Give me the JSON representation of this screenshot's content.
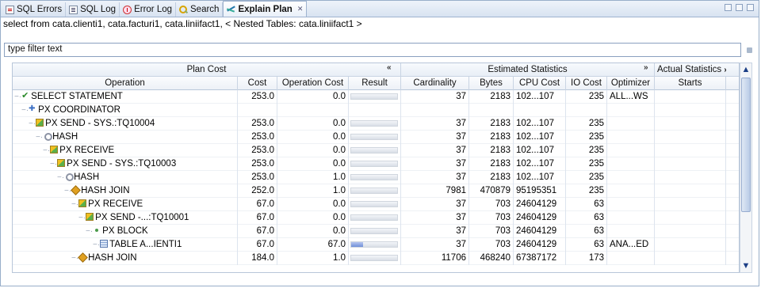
{
  "tabs": [
    {
      "label": "SQL Errors",
      "icon": "sql-errors-icon",
      "active": false
    },
    {
      "label": "SQL Log",
      "icon": "sql-log-icon",
      "active": false
    },
    {
      "label": "Error Log",
      "icon": "error-log-icon",
      "active": false
    },
    {
      "label": "Search",
      "icon": "search-icon",
      "active": false
    },
    {
      "label": "Explain Plan",
      "icon": "explain-plan-icon",
      "active": true
    }
  ],
  "sql_statement": "select from cata.clienti1, cata.facturi1, cata.liniifact1, < Nested Tables: cata.liniifact1 >",
  "filter": {
    "placeholder": "type filter text",
    "value": "type filter text"
  },
  "column_groups": {
    "plan_cost": "Plan Cost",
    "estimated_statistics": "Estimated Statistics",
    "actual_statistics": "Actual Statistics",
    "collapse_glyph": "«",
    "expand_glyph": "»"
  },
  "columns": [
    "Operation",
    "Cost",
    "Operation Cost",
    "Result",
    "Cardinality",
    "Bytes",
    "CPU Cost",
    "IO Cost",
    "Optimizer",
    "Starts"
  ],
  "rows": [
    {
      "depth": 0,
      "icon": "check",
      "operation": "SELECT STATEMENT",
      "cost": "253.0",
      "op_cost": "0.0",
      "result": 0.0,
      "cardinality": "37",
      "bytes": "2183",
      "cpu_cost": "102...107",
      "io_cost": "235",
      "optimizer": "ALL...WS",
      "starts": ""
    },
    {
      "depth": 1,
      "icon": "coord",
      "operation": "PX COORDINATOR",
      "cost": "",
      "op_cost": "",
      "result": null,
      "cardinality": "",
      "bytes": "",
      "cpu_cost": "",
      "io_cost": "",
      "optimizer": "",
      "starts": ""
    },
    {
      "depth": 2,
      "icon": "send",
      "operation": "PX SEND - SYS.:TQ10004",
      "cost": "253.0",
      "op_cost": "0.0",
      "result": 0.0,
      "cardinality": "37",
      "bytes": "2183",
      "cpu_cost": "102...107",
      "io_cost": "235",
      "optimizer": "",
      "starts": ""
    },
    {
      "depth": 3,
      "icon": "hash",
      "operation": "HASH",
      "cost": "253.0",
      "op_cost": "0.0",
      "result": 0.0,
      "cardinality": "37",
      "bytes": "2183",
      "cpu_cost": "102...107",
      "io_cost": "235",
      "optimizer": "",
      "starts": ""
    },
    {
      "depth": 4,
      "icon": "send",
      "operation": "PX RECEIVE",
      "cost": "253.0",
      "op_cost": "0.0",
      "result": 0.0,
      "cardinality": "37",
      "bytes": "2183",
      "cpu_cost": "102...107",
      "io_cost": "235",
      "optimizer": "",
      "starts": ""
    },
    {
      "depth": 5,
      "icon": "send",
      "operation": "PX SEND - SYS.:TQ10003",
      "cost": "253.0",
      "op_cost": "0.0",
      "result": 0.0,
      "cardinality": "37",
      "bytes": "2183",
      "cpu_cost": "102...107",
      "io_cost": "235",
      "optimizer": "",
      "starts": ""
    },
    {
      "depth": 6,
      "icon": "hash",
      "operation": "HASH",
      "cost": "253.0",
      "op_cost": "1.0",
      "result": 0.0,
      "cardinality": "37",
      "bytes": "2183",
      "cpu_cost": "102...107",
      "io_cost": "235",
      "optimizer": "",
      "starts": ""
    },
    {
      "depth": 7,
      "icon": "join",
      "operation": "HASH JOIN",
      "cost": "252.0",
      "op_cost": "1.0",
      "result": 0.0,
      "cardinality": "7981",
      "bytes": "470879",
      "cpu_cost": "95195351",
      "io_cost": "235",
      "optimizer": "",
      "starts": ""
    },
    {
      "depth": 8,
      "icon": "send",
      "operation": "PX RECEIVE",
      "cost": "67.0",
      "op_cost": "0.0",
      "result": 0.0,
      "cardinality": "37",
      "bytes": "703",
      "cpu_cost": "24604129",
      "io_cost": "63",
      "optimizer": "",
      "starts": ""
    },
    {
      "depth": 9,
      "icon": "send",
      "operation": "PX SEND -...:TQ10001",
      "cost": "67.0",
      "op_cost": "0.0",
      "result": 0.0,
      "cardinality": "37",
      "bytes": "703",
      "cpu_cost": "24604129",
      "io_cost": "63",
      "optimizer": "",
      "starts": ""
    },
    {
      "depth": 10,
      "icon": "block",
      "operation": "PX BLOCK",
      "cost": "67.0",
      "op_cost": "0.0",
      "result": 0.0,
      "cardinality": "37",
      "bytes": "703",
      "cpu_cost": "24604129",
      "io_cost": "63",
      "optimizer": "",
      "starts": ""
    },
    {
      "depth": 11,
      "icon": "table",
      "operation": "TABLE A...IENTI1",
      "cost": "67.0",
      "op_cost": "67.0",
      "result": 0.26,
      "cardinality": "37",
      "bytes": "703",
      "cpu_cost": "24604129",
      "io_cost": "63",
      "optimizer": "ANA...ED",
      "starts": ""
    },
    {
      "depth": 8,
      "icon": "join",
      "operation": "HASH JOIN",
      "cost": "184.0",
      "op_cost": "1.0",
      "result": 0.0,
      "cardinality": "11706",
      "bytes": "468240",
      "cpu_cost": "67387172",
      "io_cost": "173",
      "optimizer": "",
      "starts": ""
    }
  ],
  "scrollbar": {
    "up_glyph": "▲",
    "down_glyph": "▼"
  },
  "colors": {
    "bar_fill": "#6f8fd8",
    "check": "#2a8a2a",
    "tab_bg": "#d8e3f1"
  }
}
